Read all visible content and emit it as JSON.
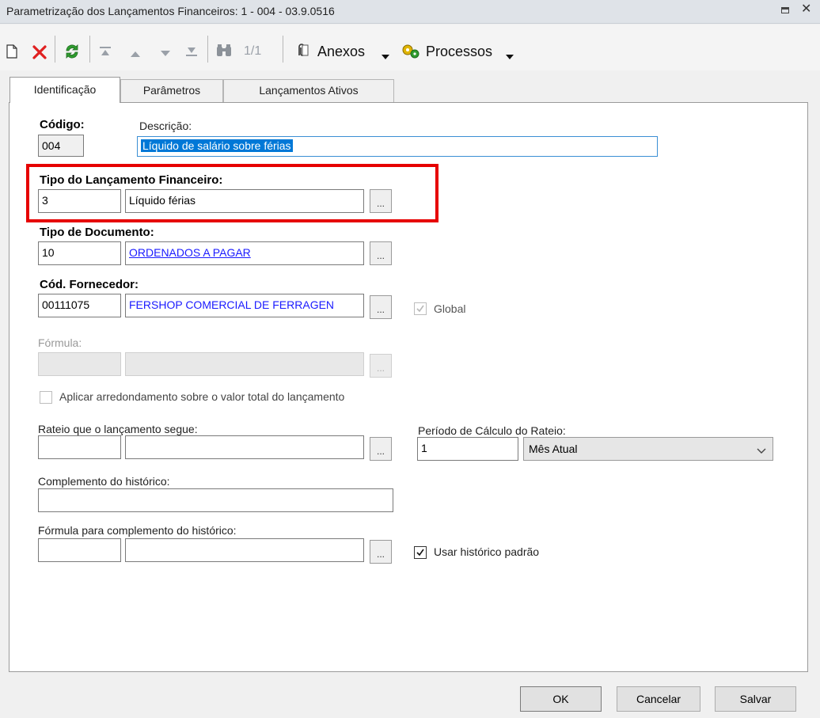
{
  "window": {
    "title": "Parametrização dos Lançamentos Financeiros: 1 - 004 - 03.9.0516"
  },
  "toolbar": {
    "record_counter": "1/1",
    "attachments_label": "Anexos",
    "processes_label": "Processos"
  },
  "tabs": [
    {
      "label": "Identificação",
      "active": true
    },
    {
      "label": "Parâmetros",
      "active": false
    },
    {
      "label": "Lançamentos Ativos",
      "active": false
    }
  ],
  "form": {
    "codigo": {
      "label": "Código:",
      "value": "004"
    },
    "descricao": {
      "label": "Descrição:",
      "value": "Líquido de salário sobre férias"
    },
    "tipo_lancamento": {
      "label": "Tipo do Lançamento Financeiro:",
      "code": "3",
      "description": "Líquido férias"
    },
    "tipo_documento": {
      "label": "Tipo de Documento:",
      "code": "10",
      "description": "ORDENADOS A PAGAR"
    },
    "fornecedor": {
      "label": "Cód. Fornecedor:",
      "code": "00111075",
      "description": "FERSHOP COMERCIAL DE FERRAGEN",
      "global_label": "Global",
      "global_checked": true
    },
    "formula": {
      "label": "Fórmula:",
      "code": "",
      "description": ""
    },
    "arredondamento": {
      "label": "Aplicar arredondamento sobre o valor total do lançamento",
      "checked": false
    },
    "rateio": {
      "label": "Rateio que o lançamento segue:",
      "code": "",
      "description": ""
    },
    "periodo": {
      "label": "Período de Cálculo do Rateio:",
      "value": "1",
      "selected": "Mês Atual"
    },
    "complemento": {
      "label": "Complemento do histórico:",
      "value": ""
    },
    "formula_complemento": {
      "label": "Fórmula para complemento do histórico:",
      "code": "",
      "description": ""
    },
    "historico_padrao": {
      "label": "Usar histórico padrão",
      "checked": true
    },
    "lookup_button_label": "..."
  },
  "buttons": {
    "ok": "OK",
    "cancel": "Cancelar",
    "save": "Salvar"
  },
  "colors": {
    "highlight": "#e60000",
    "link": "#1a1aff",
    "selection": "#0078d7"
  }
}
